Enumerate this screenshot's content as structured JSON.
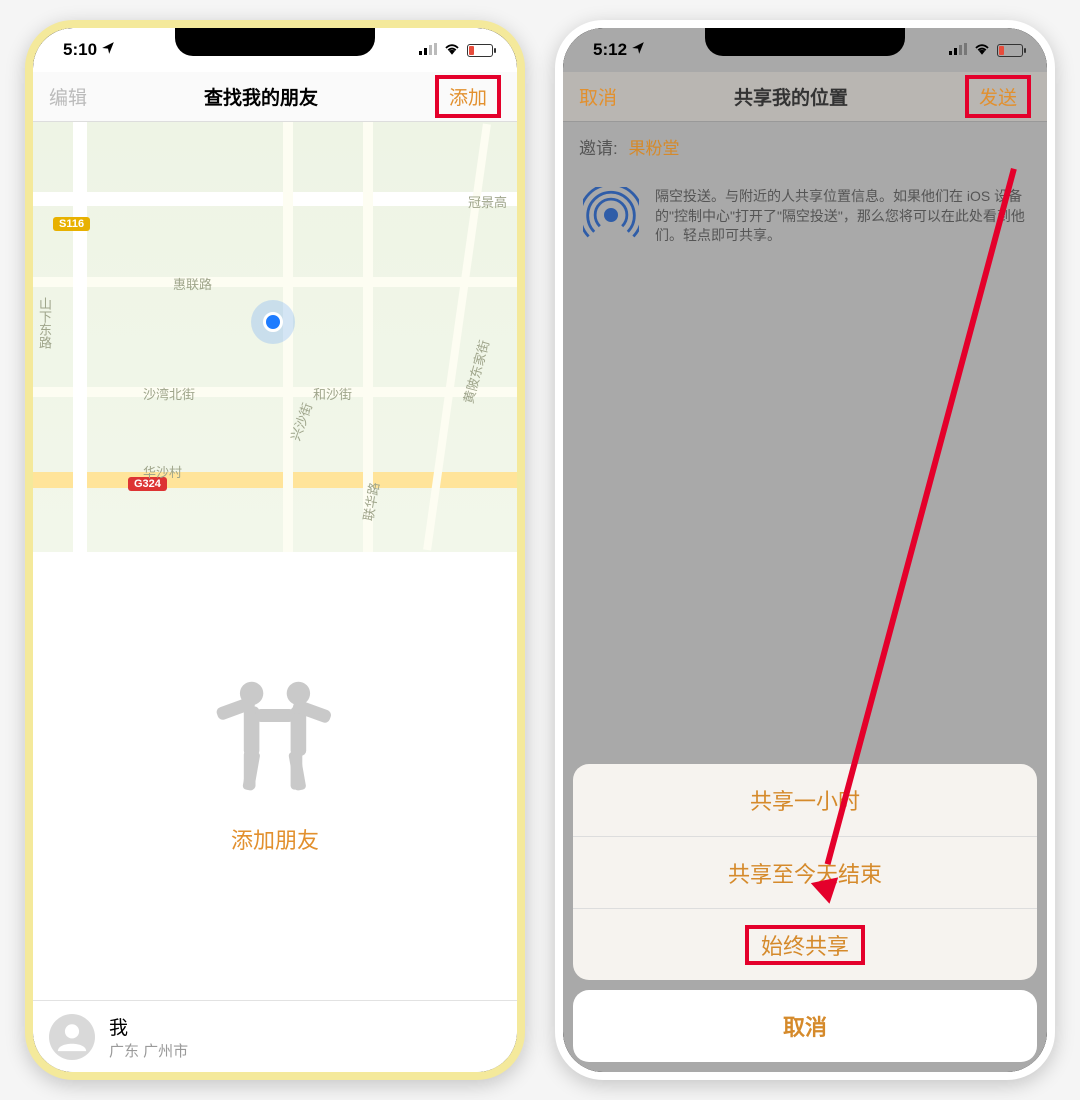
{
  "left": {
    "status_time": "5:10",
    "nav_left": "编辑",
    "nav_title": "查找我的朋友",
    "nav_right": "添加",
    "map_labels": {
      "guanjing": "冠景高",
      "huilian": "惠联路",
      "shawan": "沙湾北街",
      "hesha": "和沙街",
      "huasha": "华沙村",
      "shanxia": "山下东路",
      "xingsha": "兴沙街",
      "lianhua": "联华路",
      "huangpo": "黄陂东家街",
      "hwy_s116": "S116",
      "hwy_g324": "G324"
    },
    "add_friend": "添加朋友",
    "me_name": "我",
    "me_location": "广东 广州市"
  },
  "right": {
    "status_time": "5:12",
    "nav_left": "取消",
    "nav_title": "共享我的位置",
    "nav_right": "发送",
    "invite_label": "邀请:",
    "invite_name": "果粉堂",
    "airdrop_text": "隔空投送。与附近的人共享位置信息。如果他们在 iOS 设备的\"控制中心\"打开了\"隔空投送\"，那么您将可以在此处看到他们。轻点即可共享。",
    "sheet_options": [
      "共享一小时",
      "共享至今天结束",
      "始终共享"
    ],
    "sheet_cancel": "取消"
  }
}
